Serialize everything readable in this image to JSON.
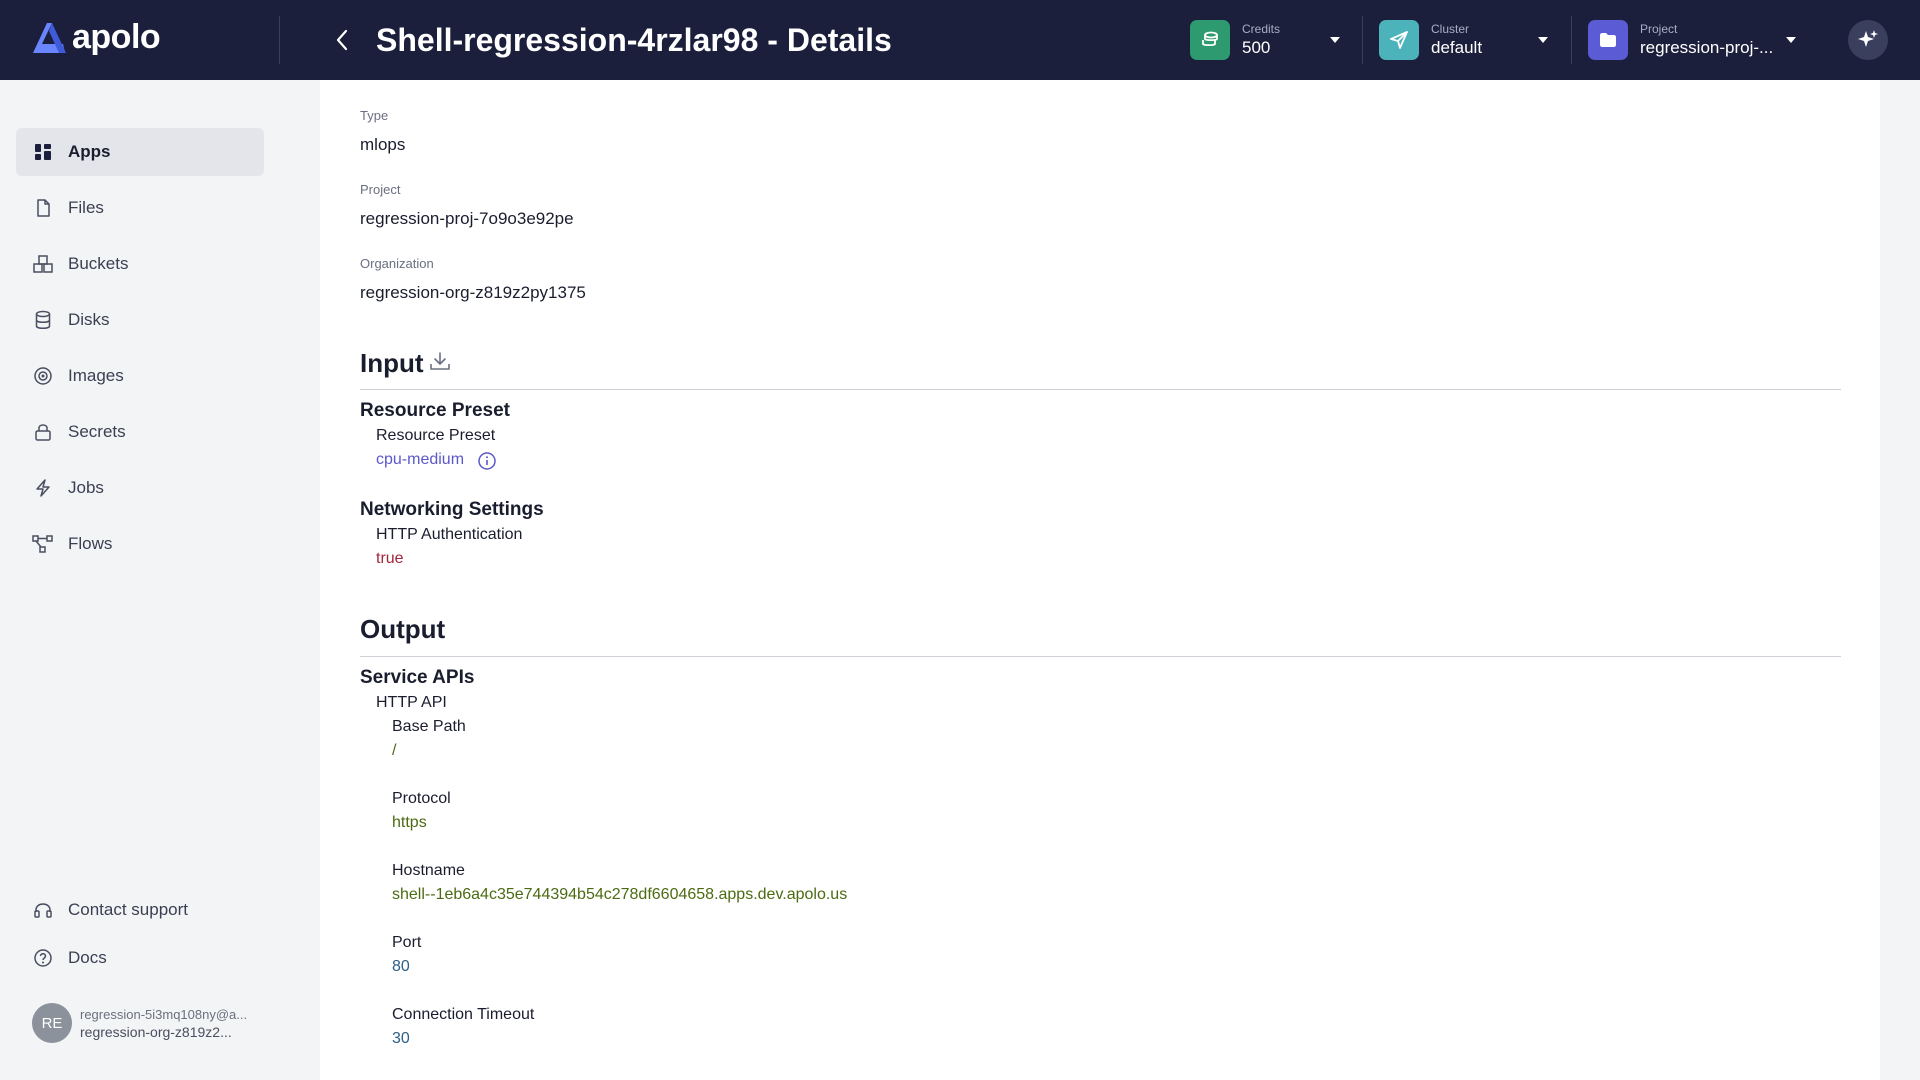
{
  "header": {
    "logo_text": "apolo",
    "title": "Shell-regression-4rzlar98 - Details",
    "credits": {
      "label": "Credits",
      "value": "500"
    },
    "cluster": {
      "label": "Cluster",
      "value": "default"
    },
    "project": {
      "label": "Project",
      "value": "regression-proj-..."
    }
  },
  "sidebar": {
    "items": [
      {
        "label": "Apps",
        "icon": "grid-icon",
        "active": true
      },
      {
        "label": "Files",
        "icon": "file-icon"
      },
      {
        "label": "Buckets",
        "icon": "bucket-icon"
      },
      {
        "label": "Disks",
        "icon": "database-icon"
      },
      {
        "label": "Images",
        "icon": "image-icon"
      },
      {
        "label": "Secrets",
        "icon": "lock-icon"
      },
      {
        "label": "Jobs",
        "icon": "lightning-icon"
      },
      {
        "label": "Flows",
        "icon": "flow-icon"
      }
    ],
    "bottom": [
      {
        "label": "Contact support",
        "icon": "headset-icon"
      },
      {
        "label": "Docs",
        "icon": "help-icon"
      }
    ],
    "user": {
      "initials": "RE",
      "email": "regression-5i3mq108ny@a...",
      "org": "regression-org-z819z2..."
    }
  },
  "details": {
    "type": {
      "label": "Type",
      "value": "mlops"
    },
    "project": {
      "label": "Project",
      "value": "regression-proj-7o9o3e92pe"
    },
    "organization": {
      "label": "Organization",
      "value": "regression-org-z819z2py1375"
    }
  },
  "input": {
    "title": "Input",
    "resource_preset": {
      "group": "Resource Preset",
      "label": "Resource Preset",
      "value": "cpu-medium"
    },
    "networking": {
      "group": "Networking Settings",
      "label": "HTTP Authentication",
      "value": "true"
    }
  },
  "output": {
    "title": "Output",
    "service_apis": {
      "group": "Service APIs",
      "http_api": "HTTP API",
      "base_path": {
        "label": "Base Path",
        "value": "/"
      },
      "protocol": {
        "label": "Protocol",
        "value": "https"
      },
      "hostname": {
        "label": "Hostname",
        "value": "shell--1eb6a4c35e744394b54c278df6604658.apps.dev.apolo.us"
      },
      "port": {
        "label": "Port",
        "value": "80"
      },
      "timeout": {
        "label": "Connection Timeout",
        "value": "30"
      }
    }
  },
  "colors": {
    "header_bg": "#1b1f3b",
    "credits_accent": "#2e9a6f",
    "cluster_accent": "#4bb3b9",
    "project_accent": "#5b5bd6",
    "logo_accent": "#6a86ff"
  }
}
